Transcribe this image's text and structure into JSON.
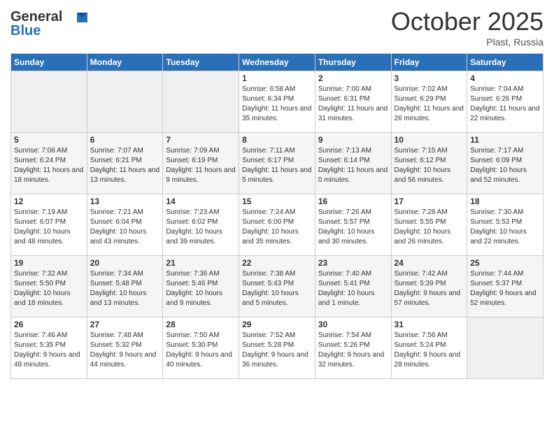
{
  "header": {
    "logo_line1": "General",
    "logo_line2": "Blue",
    "month": "October 2025",
    "location": "Plast, Russia"
  },
  "weekdays": [
    "Sunday",
    "Monday",
    "Tuesday",
    "Wednesday",
    "Thursday",
    "Friday",
    "Saturday"
  ],
  "weeks": [
    [
      {
        "day": "",
        "sunrise": "",
        "sunset": "",
        "daylight": ""
      },
      {
        "day": "",
        "sunrise": "",
        "sunset": "",
        "daylight": ""
      },
      {
        "day": "",
        "sunrise": "",
        "sunset": "",
        "daylight": ""
      },
      {
        "day": "1",
        "sunrise": "Sunrise: 6:58 AM",
        "sunset": "Sunset: 6:34 PM",
        "daylight": "Daylight: 11 hours and 35 minutes."
      },
      {
        "day": "2",
        "sunrise": "Sunrise: 7:00 AM",
        "sunset": "Sunset: 6:31 PM",
        "daylight": "Daylight: 11 hours and 31 minutes."
      },
      {
        "day": "3",
        "sunrise": "Sunrise: 7:02 AM",
        "sunset": "Sunset: 6:29 PM",
        "daylight": "Daylight: 11 hours and 26 minutes."
      },
      {
        "day": "4",
        "sunrise": "Sunrise: 7:04 AM",
        "sunset": "Sunset: 6:26 PM",
        "daylight": "Daylight: 11 hours and 22 minutes."
      }
    ],
    [
      {
        "day": "5",
        "sunrise": "Sunrise: 7:06 AM",
        "sunset": "Sunset: 6:24 PM",
        "daylight": "Daylight: 11 hours and 18 minutes."
      },
      {
        "day": "6",
        "sunrise": "Sunrise: 7:07 AM",
        "sunset": "Sunset: 6:21 PM",
        "daylight": "Daylight: 11 hours and 13 minutes."
      },
      {
        "day": "7",
        "sunrise": "Sunrise: 7:09 AM",
        "sunset": "Sunset: 6:19 PM",
        "daylight": "Daylight: 11 hours and 9 minutes."
      },
      {
        "day": "8",
        "sunrise": "Sunrise: 7:11 AM",
        "sunset": "Sunset: 6:17 PM",
        "daylight": "Daylight: 11 hours and 5 minutes."
      },
      {
        "day": "9",
        "sunrise": "Sunrise: 7:13 AM",
        "sunset": "Sunset: 6:14 PM",
        "daylight": "Daylight: 11 hours and 0 minutes."
      },
      {
        "day": "10",
        "sunrise": "Sunrise: 7:15 AM",
        "sunset": "Sunset: 6:12 PM",
        "daylight": "Daylight: 10 hours and 56 minutes."
      },
      {
        "day": "11",
        "sunrise": "Sunrise: 7:17 AM",
        "sunset": "Sunset: 6:09 PM",
        "daylight": "Daylight: 10 hours and 52 minutes."
      }
    ],
    [
      {
        "day": "12",
        "sunrise": "Sunrise: 7:19 AM",
        "sunset": "Sunset: 6:07 PM",
        "daylight": "Daylight: 10 hours and 48 minutes."
      },
      {
        "day": "13",
        "sunrise": "Sunrise: 7:21 AM",
        "sunset": "Sunset: 6:04 PM",
        "daylight": "Daylight: 10 hours and 43 minutes."
      },
      {
        "day": "14",
        "sunrise": "Sunrise: 7:23 AM",
        "sunset": "Sunset: 6:02 PM",
        "daylight": "Daylight: 10 hours and 39 minutes."
      },
      {
        "day": "15",
        "sunrise": "Sunrise: 7:24 AM",
        "sunset": "Sunset: 6:00 PM",
        "daylight": "Daylight: 10 hours and 35 minutes."
      },
      {
        "day": "16",
        "sunrise": "Sunrise: 7:26 AM",
        "sunset": "Sunset: 5:57 PM",
        "daylight": "Daylight: 10 hours and 30 minutes."
      },
      {
        "day": "17",
        "sunrise": "Sunrise: 7:28 AM",
        "sunset": "Sunset: 5:55 PM",
        "daylight": "Daylight: 10 hours and 26 minutes."
      },
      {
        "day": "18",
        "sunrise": "Sunrise: 7:30 AM",
        "sunset": "Sunset: 5:53 PM",
        "daylight": "Daylight: 10 hours and 22 minutes."
      }
    ],
    [
      {
        "day": "19",
        "sunrise": "Sunrise: 7:32 AM",
        "sunset": "Sunset: 5:50 PM",
        "daylight": "Daylight: 10 hours and 18 minutes."
      },
      {
        "day": "20",
        "sunrise": "Sunrise: 7:34 AM",
        "sunset": "Sunset: 5:48 PM",
        "daylight": "Daylight: 10 hours and 13 minutes."
      },
      {
        "day": "21",
        "sunrise": "Sunrise: 7:36 AM",
        "sunset": "Sunset: 5:46 PM",
        "daylight": "Daylight: 10 hours and 9 minutes."
      },
      {
        "day": "22",
        "sunrise": "Sunrise: 7:38 AM",
        "sunset": "Sunset: 5:43 PM",
        "daylight": "Daylight: 10 hours and 5 minutes."
      },
      {
        "day": "23",
        "sunrise": "Sunrise: 7:40 AM",
        "sunset": "Sunset: 5:41 PM",
        "daylight": "Daylight: 10 hours and 1 minute."
      },
      {
        "day": "24",
        "sunrise": "Sunrise: 7:42 AM",
        "sunset": "Sunset: 5:39 PM",
        "daylight": "Daylight: 9 hours and 57 minutes."
      },
      {
        "day": "25",
        "sunrise": "Sunrise: 7:44 AM",
        "sunset": "Sunset: 5:37 PM",
        "daylight": "Daylight: 9 hours and 52 minutes."
      }
    ],
    [
      {
        "day": "26",
        "sunrise": "Sunrise: 7:46 AM",
        "sunset": "Sunset: 5:35 PM",
        "daylight": "Daylight: 9 hours and 48 minutes."
      },
      {
        "day": "27",
        "sunrise": "Sunrise: 7:48 AM",
        "sunset": "Sunset: 5:32 PM",
        "daylight": "Daylight: 9 hours and 44 minutes."
      },
      {
        "day": "28",
        "sunrise": "Sunrise: 7:50 AM",
        "sunset": "Sunset: 5:30 PM",
        "daylight": "Daylight: 9 hours and 40 minutes."
      },
      {
        "day": "29",
        "sunrise": "Sunrise: 7:52 AM",
        "sunset": "Sunset: 5:28 PM",
        "daylight": "Daylight: 9 hours and 36 minutes."
      },
      {
        "day": "30",
        "sunrise": "Sunrise: 7:54 AM",
        "sunset": "Sunset: 5:26 PM",
        "daylight": "Daylight: 9 hours and 32 minutes."
      },
      {
        "day": "31",
        "sunrise": "Sunrise: 7:56 AM",
        "sunset": "Sunset: 5:24 PM",
        "daylight": "Daylight: 9 hours and 28 minutes."
      },
      {
        "day": "",
        "sunrise": "",
        "sunset": "",
        "daylight": ""
      }
    ]
  ]
}
